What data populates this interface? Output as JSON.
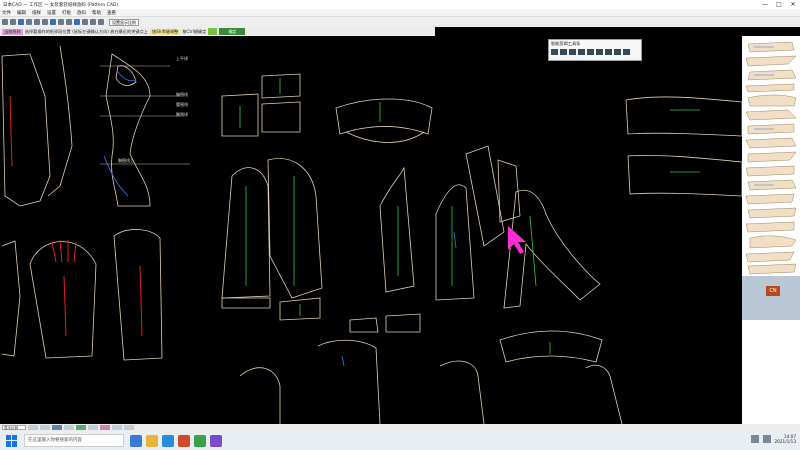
{
  "window": {
    "title": "日本CAD — 工作区 — 女装套装纸样放码 (Pattern CAD)",
    "controls": {
      "minimize": "—",
      "maximize": "□",
      "close": "✕"
    }
  },
  "menu": [
    "文件",
    "编辑",
    "纸样",
    "设置",
    "打板",
    "放码",
    "帮助",
    "查看"
  ],
  "toolbar": {
    "zoom_value": "设置显示比例"
  },
  "toolbar2": {
    "items": [
      {
        "text": "当前纸样",
        "style": "pink"
      },
      {
        "text": "选择要操作的纸样段位置 (鼠标左键确认方向) 放在最近的关键点上",
        "style": "plain"
      },
      {
        "text": "按Shift键调整",
        "style": "yellow"
      },
      {
        "text": "按Ctrl键确定",
        "style": "plain"
      }
    ],
    "green_button": "确定"
  },
  "float_panel": {
    "title": "智能剪辑工具条"
  },
  "canvas_labels": [
    "上平线",
    "胸围线",
    "腰围线",
    "臀围线",
    "胸围线上"
  ],
  "right_panel": {
    "cn_button": "CN"
  },
  "status": {
    "input_value": "显示比例"
  },
  "taskbar": {
    "search_placeholder": "在这里输入你要搜索的内容",
    "time": "14:07",
    "date": "2021/1/13"
  },
  "colors": {
    "canvas_bg": "#000000",
    "pattern_outline": "#e0d0b0",
    "grain_line": "#2ecc40",
    "marker_red": "#e02020",
    "marker_blue": "#3a6ae0",
    "cursor_magenta": "#ff2bd6"
  },
  "icons": [
    "start-icon",
    "cursor-icon",
    "cn-icon"
  ]
}
